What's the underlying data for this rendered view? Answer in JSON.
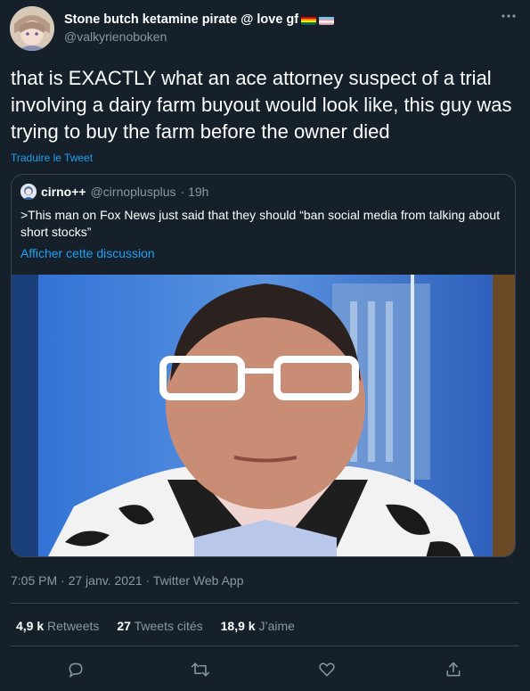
{
  "author": {
    "display_name": "Stone butch ketamine pirate @ love gf",
    "handle": "@valkyrienoboken",
    "flags": [
      "rainbow-flag-icon",
      "trans-flag-icon"
    ]
  },
  "tweet": {
    "text": "that is EXACTLY what an ace attorney suspect of a trial involving a dairy farm buyout would look like, this guy was trying to buy the farm before the owner died",
    "translate_label": "Traduire le Tweet"
  },
  "quote": {
    "name": "cirno++",
    "handle": "@cirnoplusplus",
    "time": "· 19h",
    "text": ">This man on Fox News just said that they should “ban social media from talking about short stocks”",
    "link": "Afficher cette discussion"
  },
  "meta": {
    "time": "7:05 PM · 27 janv. 2021 · Twitter Web App"
  },
  "stats": {
    "retweets_count": "4,9 k",
    "retweets_label": "Retweets",
    "quotes_count": "27",
    "quotes_label": "Tweets cités",
    "likes_count": "18,9 k",
    "likes_label": "J’aime"
  },
  "colors": {
    "background": "#15202b",
    "secondary_text": "#8899a6",
    "accent": "#1da1f2",
    "border": "#38444d"
  },
  "icons": [
    "more-icon",
    "reply-icon",
    "retweet-icon",
    "like-icon",
    "share-icon"
  ]
}
